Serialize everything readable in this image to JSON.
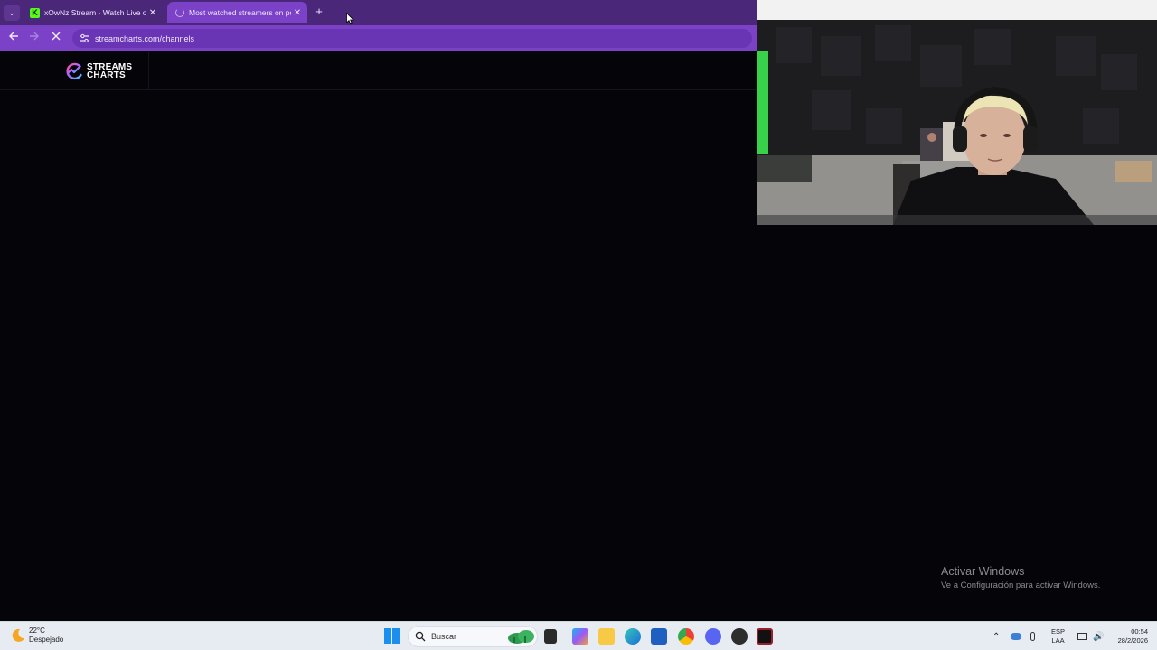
{
  "browser": {
    "tabs": [
      {
        "title": "xOwNz Stream - Watch Live on Kick",
        "favicon": "kick-logo-icon",
        "favicon_letter": "K",
        "active": false
      },
      {
        "title": "Most watched streamers on popular platforms",
        "favicon": "loading-spinner-icon",
        "active": true
      }
    ],
    "new_tab_label": "+",
    "close_glyph": "✕",
    "url": "streamcharts.com/channels",
    "theme_color": "#7b42c8"
  },
  "page": {
    "logo_line1": "STREAMS",
    "logo_line2": "CHARTS",
    "background": "#050409"
  },
  "watermark": {
    "title": "Activar Windows",
    "subtitle": "Ve a Configuración para activar Windows."
  },
  "taskbar": {
    "weather_temp": "22°C",
    "weather_desc": "Despejado",
    "search_placeholder": "Buscar",
    "lang_line1": "ESP",
    "lang_line2": "LAA",
    "time": "00:54",
    "date": "28/2/2026",
    "pinned_apps": [
      "file-explorer-icon",
      "copilot-icon",
      "folder-icon",
      "edge-icon",
      "store-icon",
      "chrome-icon",
      "discord-icon",
      "app-icon",
      "epic-games-icon"
    ]
  }
}
